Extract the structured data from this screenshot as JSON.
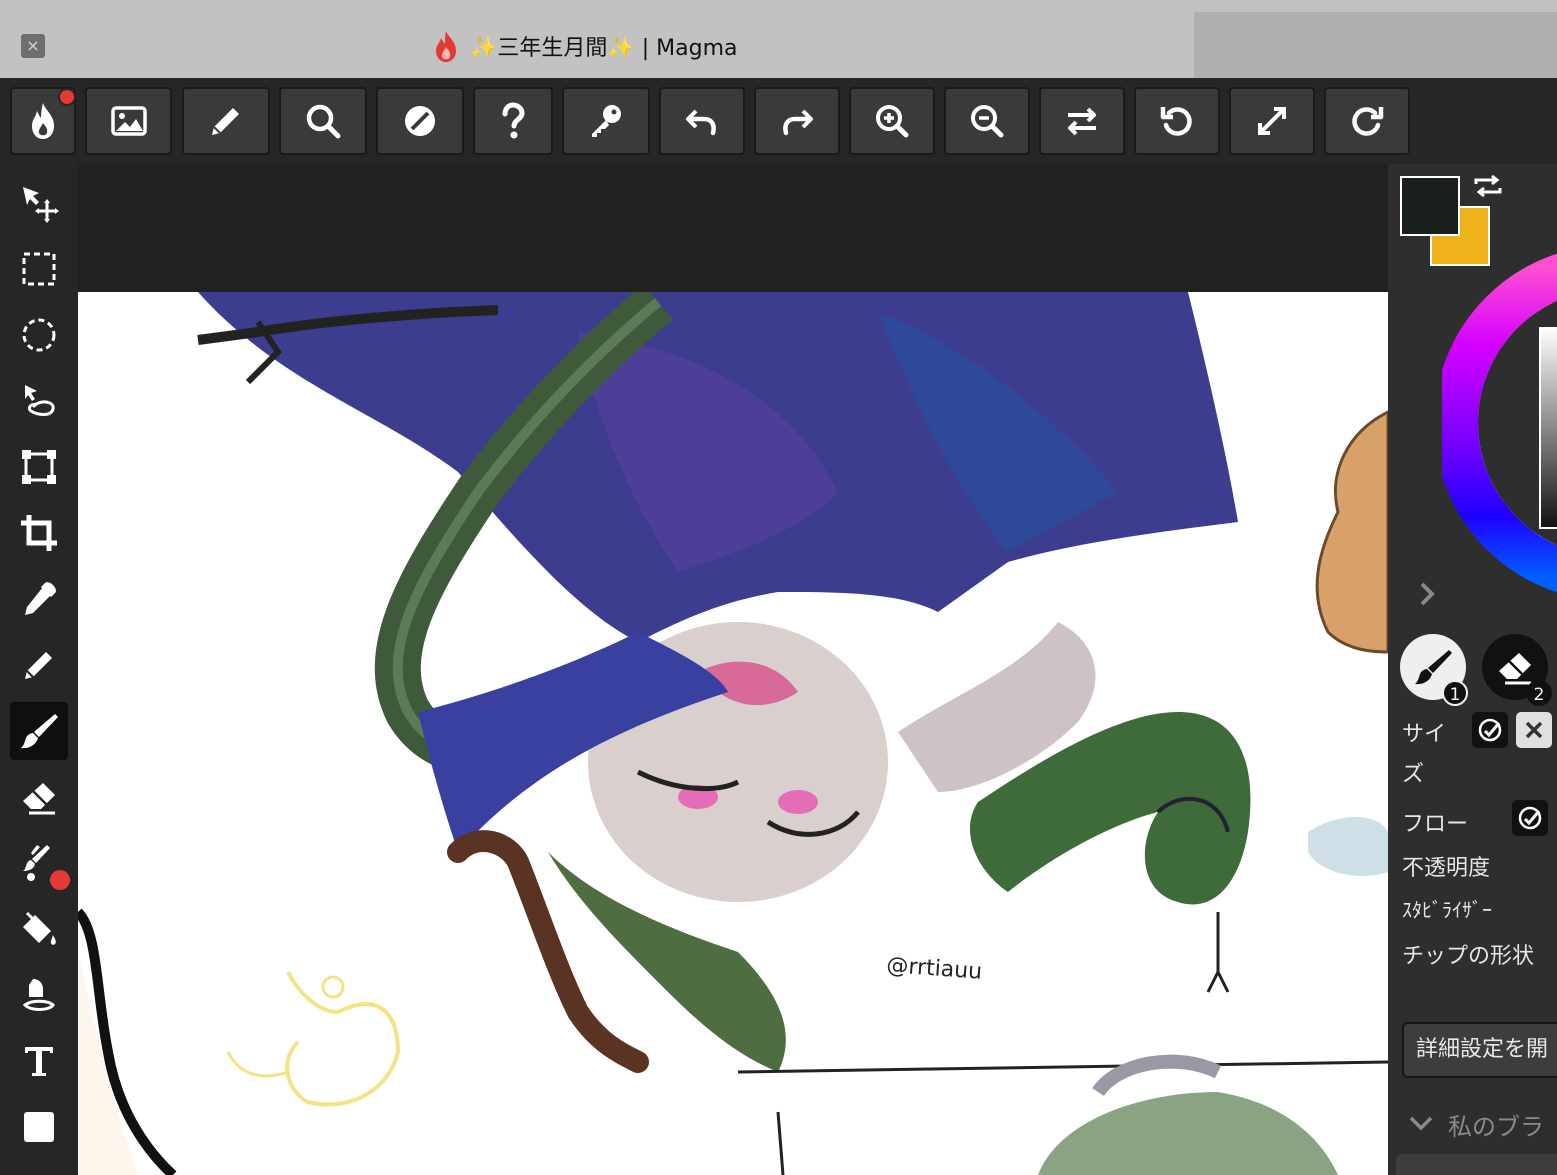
{
  "tab": {
    "close_label": "×",
    "title": "✨三年生月間✨ | Magma"
  },
  "toolbar": {
    "buttons": [
      {
        "name": "magma-menu",
        "icon": "magma-logo-icon"
      },
      {
        "name": "image",
        "icon": "image-icon"
      },
      {
        "name": "pencil",
        "icon": "pencil-icon"
      },
      {
        "name": "search",
        "icon": "search-icon"
      },
      {
        "name": "adjust",
        "icon": "contrast-icon"
      },
      {
        "name": "help",
        "icon": "question-icon"
      },
      {
        "name": "key",
        "icon": "key-icon"
      },
      {
        "name": "undo",
        "icon": "undo-icon"
      },
      {
        "name": "redo",
        "icon": "redo-icon"
      },
      {
        "name": "zoom-in",
        "icon": "zoom-in-icon"
      },
      {
        "name": "zoom-out",
        "icon": "zoom-out-icon"
      },
      {
        "name": "flip",
        "icon": "swap-arrows-icon"
      },
      {
        "name": "rotate-left",
        "icon": "rotate-left-icon"
      },
      {
        "name": "fit",
        "icon": "expand-icon"
      },
      {
        "name": "rotate-right",
        "icon": "rotate-right-icon"
      }
    ]
  },
  "tools": [
    {
      "name": "move",
      "icon": "move-icon"
    },
    {
      "name": "rect-select",
      "icon": "rect-select-icon"
    },
    {
      "name": "ellipse-select",
      "icon": "ellipse-select-icon"
    },
    {
      "name": "lasso",
      "icon": "lasso-icon"
    },
    {
      "name": "transform",
      "icon": "transform-icon"
    },
    {
      "name": "crop",
      "icon": "crop-icon"
    },
    {
      "name": "eyedropper",
      "icon": "eyedropper-icon"
    },
    {
      "name": "pencil",
      "icon": "pencil-icon"
    },
    {
      "name": "brush",
      "icon": "brush-icon",
      "active": true
    },
    {
      "name": "eraser",
      "icon": "eraser-icon"
    },
    {
      "name": "brush-set",
      "icon": "brushes-icon"
    },
    {
      "name": "bucket",
      "icon": "paint-bucket-icon"
    },
    {
      "name": "smudge",
      "icon": "smudge-icon"
    },
    {
      "name": "text",
      "icon": "text-icon"
    },
    {
      "name": "shape",
      "icon": "square-icon"
    }
  ],
  "colors": {
    "foreground": "#19201b",
    "background": "#eeb31b",
    "accent_dot": "#e53935"
  },
  "brush_slots": [
    {
      "number": "1",
      "icon": "brush-icon"
    },
    {
      "number": "2",
      "icon": "eraser-icon"
    }
  ],
  "brush_props": {
    "size_line1": "サイ",
    "size_line2": "ズ",
    "flow": "フロー",
    "opacity": "不透明度",
    "stabilizer": "ｽﾀﾋﾞﾗｲｻﾞｰ",
    "tip_shape": "チップの形状"
  },
  "advanced_button": "詳細設定を開",
  "my_brushes": "私のブラ",
  "canvas": {
    "signature": "@rrtiauu"
  }
}
